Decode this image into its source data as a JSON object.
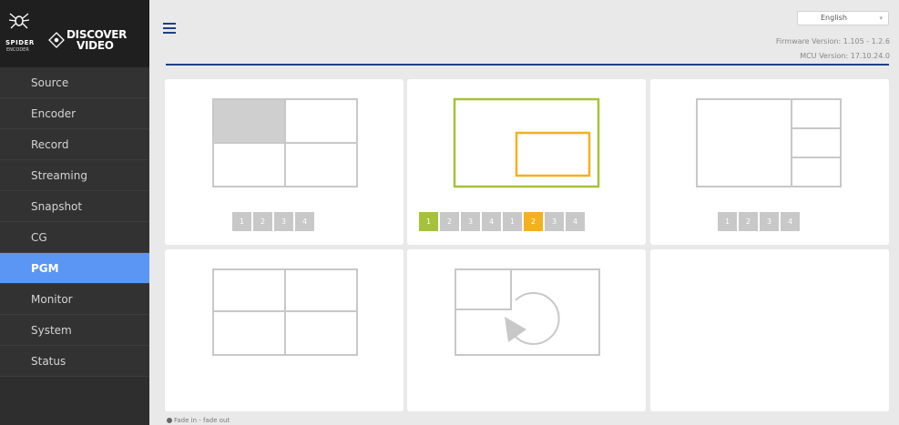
{
  "brand": {
    "spider_word": "SPIDER",
    "encoder_word": "ENCODER",
    "discover_line1": "DISCOVER",
    "discover_line2": "VIDEO"
  },
  "sidebar": {
    "items": [
      {
        "label": "Source"
      },
      {
        "label": "Encoder"
      },
      {
        "label": "Record"
      },
      {
        "label": "Streaming"
      },
      {
        "label": "Snapshot"
      },
      {
        "label": "CG"
      },
      {
        "label": "PGM",
        "active": true
      },
      {
        "label": "Monitor"
      },
      {
        "label": "System"
      },
      {
        "label": "Status"
      }
    ]
  },
  "header": {
    "menu_icon": "hamburger-icon",
    "language": "English",
    "firmware": "Firmware Version: 1.105 - 1.2.6",
    "mcu": "MCU Version: 17.10.24.0"
  },
  "layouts": [
    {
      "type": "quad-highlight-first",
      "buttons": [
        "1",
        "2",
        "3",
        "4"
      ]
    },
    {
      "type": "picture-in-picture",
      "buttons": [
        "1",
        "2",
        "3",
        "4",
        "1",
        "2",
        "3",
        "4"
      ],
      "selected": {
        "first": "1",
        "second": "2"
      }
    },
    {
      "type": "one-large-three-small",
      "buttons": [
        "1",
        "2",
        "3",
        "4"
      ]
    },
    {
      "type": "quad",
      "buttons": []
    },
    {
      "type": "rotate-transition",
      "buttons": []
    },
    {
      "type": "empty",
      "buttons": []
    }
  ],
  "colors": {
    "accent": "#5b96f5",
    "header_rule": "#1f3f85",
    "green": "#a6c13a",
    "orange": "#f4b020",
    "outline_gray": "#c8c8c8"
  },
  "footer": {
    "note": "Fade in - fade out"
  }
}
